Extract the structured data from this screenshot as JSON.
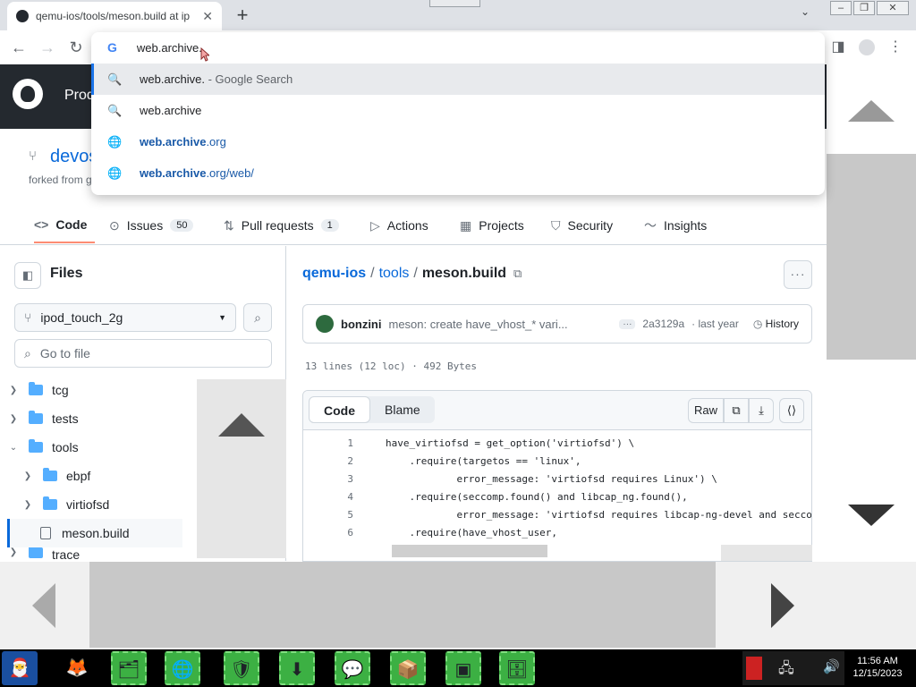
{
  "browser": {
    "tab_title": "qemu-ios/tools/meson.build at ip",
    "tab_close": "✕",
    "new_tab": "+",
    "omnibox_text": "web.archive.",
    "suggestions": [
      {
        "bold": "",
        "text": "web.archive.",
        "dim": " - Google Search",
        "icon": "search-icon",
        "glyph": "🔍"
      },
      {
        "bold": "",
        "text": "web.archive",
        "dim": "",
        "icon": "search-icon",
        "glyph": "🔍"
      },
      {
        "bold": "web.archive",
        "text": ".org",
        "dim": "",
        "icon": "globe-icon",
        "glyph": "🌐"
      },
      {
        "bold": "web.archive",
        "text": ".org/web/",
        "dim": "",
        "icon": "globe-icon",
        "glyph": "🌐"
      }
    ]
  },
  "github": {
    "product": "Prod",
    "repo_name": "devos",
    "forked_from": "forked from g",
    "nav": [
      {
        "label": "Code",
        "icon": "code-icon",
        "glyph": "<>",
        "count": ""
      },
      {
        "label": "Issues",
        "icon": "issues-icon",
        "glyph": "⊙",
        "count": "50"
      },
      {
        "label": "Pull requests",
        "icon": "pull-request-icon",
        "glyph": "⇅",
        "count": "1"
      },
      {
        "label": "Actions",
        "icon": "actions-icon",
        "glyph": "▷",
        "count": ""
      },
      {
        "label": "Projects",
        "icon": "projects-icon",
        "glyph": "▦",
        "count": ""
      },
      {
        "label": "Security",
        "icon": "security-icon",
        "glyph": "⛉",
        "count": ""
      },
      {
        "label": "Insights",
        "icon": "insights-icon",
        "glyph": "〜",
        "count": ""
      }
    ],
    "files": {
      "title": "Files",
      "branch": "ipod_touch_2g",
      "goto_placeholder": "Go to file",
      "tree": [
        {
          "name": "tcg",
          "type": "folder",
          "expanded": false
        },
        {
          "name": "tests",
          "type": "folder",
          "expanded": false
        },
        {
          "name": "tools",
          "type": "folder",
          "expanded": true
        },
        {
          "name": "ebpf",
          "type": "folder",
          "expanded": false
        },
        {
          "name": "virtiofsd",
          "type": "folder",
          "expanded": false
        },
        {
          "name": "meson.build",
          "type": "file",
          "expanded": false
        },
        {
          "name": "trace",
          "type": "folder",
          "expanded": false
        }
      ]
    },
    "breadcrumb": {
      "repo": "qemu-ios",
      "dir": "tools",
      "file": "meson.build"
    },
    "commit": {
      "author": "bonzini",
      "message": "meson: create have_vhost_* vari...",
      "sha": "2a3129a",
      "when": "· last year",
      "history": "History"
    },
    "file_meta": "13 lines (12 loc) · 492 Bytes",
    "code_tabs": {
      "code": "Code",
      "blame": "Blame",
      "raw": "Raw"
    },
    "code_lines": [
      {
        "n": "1",
        "text": "have_virtiofsd = get_option('virtiofsd') \\"
      },
      {
        "n": "2",
        "text": "    .require(targetos == 'linux',"
      },
      {
        "n": "3",
        "text": "            error_message: 'virtiofsd requires Linux') \\"
      },
      {
        "n": "4",
        "text": "    .require(seccomp.found() and libcap_ng.found(),"
      },
      {
        "n": "5",
        "text": "            error_message: 'virtiofsd requires libcap-ng-devel and secco"
      },
      {
        "n": "6",
        "text": "    .require(have_vhost_user,"
      }
    ]
  },
  "taskbar": {
    "time": "11:56 AM",
    "date": "12/15/2023"
  }
}
